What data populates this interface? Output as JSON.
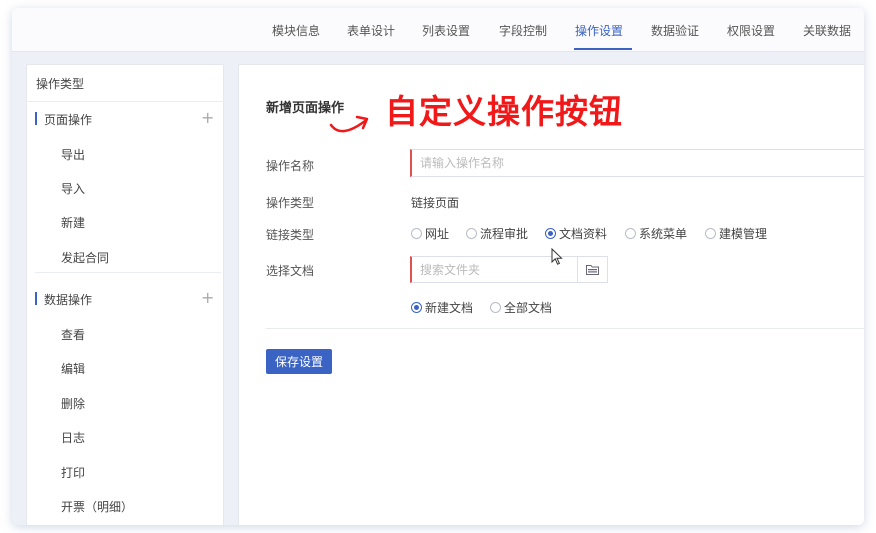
{
  "tabs": [
    {
      "label": "模块信息",
      "active": false
    },
    {
      "label": "表单设计",
      "active": false
    },
    {
      "label": "列表设置",
      "active": false
    },
    {
      "label": "字段控制",
      "active": false
    },
    {
      "label": "操作设置",
      "active": true
    },
    {
      "label": "数据验证",
      "active": false
    },
    {
      "label": "权限设置",
      "active": false
    },
    {
      "label": "关联数据",
      "active": false
    }
  ],
  "sidebar": {
    "title": "操作类型",
    "groups": [
      {
        "label": "页面操作",
        "add_icon": "plus-icon",
        "items": [
          "导出",
          "导入",
          "新建",
          "发起合同"
        ]
      },
      {
        "label": "数据操作",
        "add_icon": "plus-icon",
        "items": [
          "查看",
          "编辑",
          "删除",
          "日志",
          "打印",
          "开票（明细）"
        ]
      }
    ]
  },
  "main": {
    "title": "新增页面操作",
    "annotation": "自定义操作按钮",
    "fields": {
      "name_label": "操作名称",
      "name_placeholder": "请输入操作名称",
      "name_value": "",
      "type_label": "操作类型",
      "type_value": "链接页面",
      "link_type_label": "链接类型",
      "link_type_options": [
        "网址",
        "流程审批",
        "文档资料",
        "系统菜单",
        "建模管理"
      ],
      "link_type_selected": "文档资料",
      "doc_label": "选择文档",
      "doc_placeholder": "搜索文件夹",
      "doc_icon": "folder-icon",
      "doc_scope_options": [
        "新建文档",
        "全部文档"
      ],
      "doc_scope_selected": "新建文档"
    },
    "save_label": "保存设置"
  },
  "colors": {
    "accent": "#3a63c4",
    "annotation": "#f01818",
    "required": "#e05050"
  }
}
